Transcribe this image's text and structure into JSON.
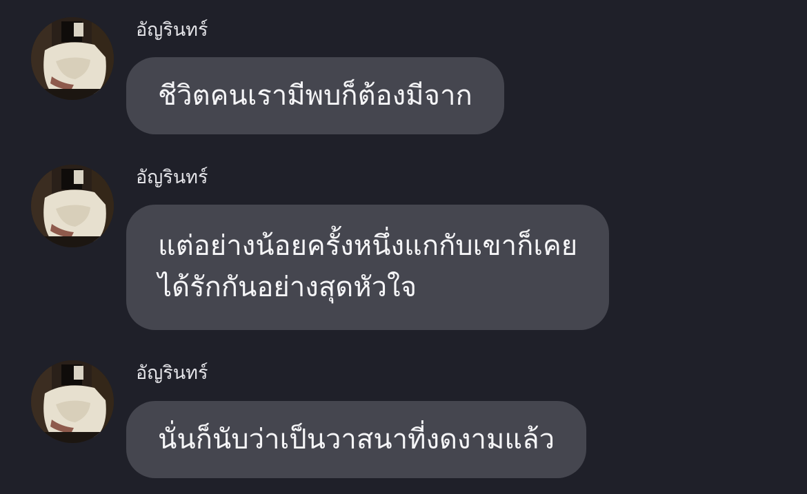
{
  "conversation": {
    "messages": [
      {
        "sender": "อัญรินทร์",
        "lines": [
          "ชีวิตคนเรามีพบก็ต้องมีจาก"
        ]
      },
      {
        "sender": "อัญรินทร์",
        "lines": [
          "แต่อย่างน้อยครั้งหนึ่งแกกับเขาก็เคย",
          "ได้รักกันอย่างสุดหัวใจ"
        ]
      },
      {
        "sender": "อัญรินทร์",
        "lines": [
          "นั่นก็นับว่าเป็นวาสนาที่งดงามแล้ว"
        ]
      }
    ]
  },
  "colors": {
    "background": "#1f2029",
    "bubble": "#45464f",
    "text": "#f5f5f7"
  },
  "icons": {
    "avatar": "profile-photo"
  }
}
